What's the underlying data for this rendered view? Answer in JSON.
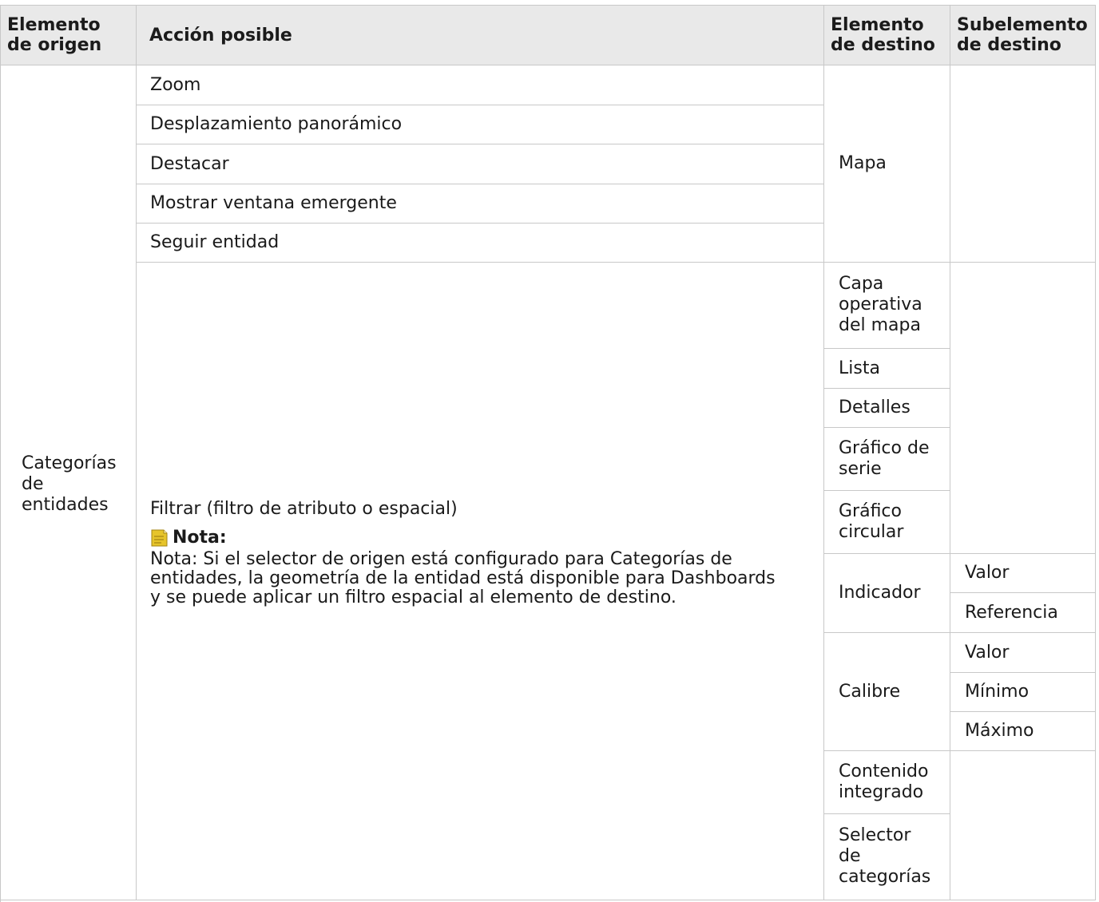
{
  "table": {
    "headers": {
      "origin": "Elemento de origen",
      "action": "Acción posible",
      "destination": "Elemento de destino",
      "subelement": "Subelemento de destino"
    },
    "origin_element": "Categorías de entidades",
    "map_actions": [
      "Zoom",
      "Desplazamiento panorámico",
      "Destacar",
      "Mostrar ventana emergente",
      "Seguir entidad"
    ],
    "map_destination": "Mapa",
    "filter_action": "Filtrar (filtro de atributo o espacial)",
    "note_title": "Nota:",
    "note_text": "Nota: Si el selector de origen está configurado para Categorías de entidades, la geometría de la entidad está disponible para Dashboards y se puede aplicar un filtro espacial al elemento de destino.",
    "filter_destinations": {
      "operational_layer": "Capa operativa del mapa",
      "list": "Lista",
      "details": "Detalles",
      "serial_chart": "Gráfico de serie",
      "pie_chart": "Gráfico circular",
      "indicator": "Indicador",
      "gauge": "Calibre",
      "embedded_content": "Contenido integrado",
      "category_selector": "Selector de categorías"
    },
    "indicator_subelements": [
      "Valor",
      "Referencia"
    ],
    "gauge_subelements": [
      "Valor",
      "Mínimo",
      "Máximo"
    ]
  },
  "colors": {
    "header_background": "#e9e9e9",
    "border": "#c8c8c8",
    "note_icon": "#e6c42a"
  },
  "icons": {
    "note": "note-icon"
  }
}
